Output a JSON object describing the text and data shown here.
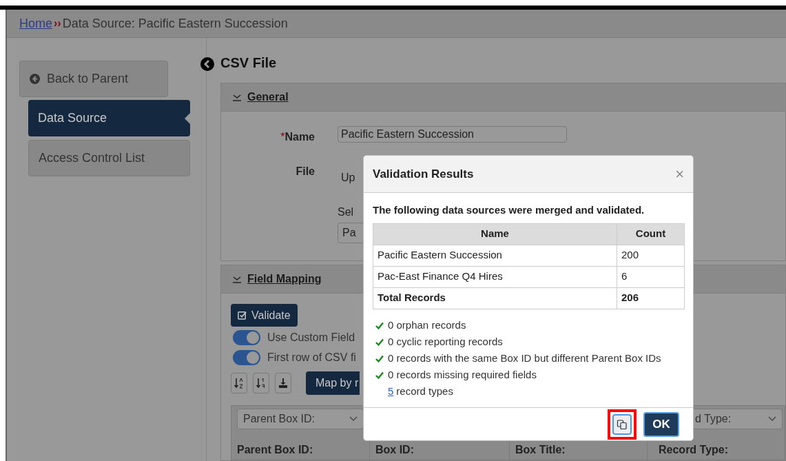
{
  "breadcrumb": {
    "home": "Home",
    "separator": "››",
    "current": "Data Source: Pacific Eastern Succession"
  },
  "sidebar": {
    "back_button": "Back to Parent",
    "items": [
      {
        "label": "Data Source",
        "selected": true
      },
      {
        "label": "Access Control List",
        "selected": false
      }
    ]
  },
  "page_title": "CSV File",
  "general": {
    "title": "General",
    "expanded": true,
    "name_field": {
      "required_mark": "*",
      "label": "Name",
      "value": "Pacific Eastern Succession"
    },
    "file_field": {
      "label": "File",
      "upload_text": "Up",
      "select_label": "Sel",
      "select_value": "Pa"
    }
  },
  "field_mapping": {
    "title": "Field Mapping",
    "expanded": true,
    "validate_button": "Validate",
    "toggles": [
      {
        "label": "Use Custom Field",
        "on": true
      },
      {
        "label": "First row of CSV fi",
        "on": true
      }
    ],
    "map_button": "Map by r",
    "columns": [
      {
        "select": "Parent Box ID:",
        "label": "Parent Box ID:"
      },
      {
        "label": "Box ID:"
      },
      {
        "label": "Box Title:"
      },
      {
        "select": "d Type:",
        "label": "Record Type:"
      }
    ]
  },
  "dialog": {
    "title": "Validation Results",
    "close": "×",
    "intro": "The following data sources were merged and validated.",
    "table": {
      "columns": [
        "Name",
        "Count"
      ],
      "rows": [
        {
          "name": "Pacific Eastern Succession",
          "count": "200"
        },
        {
          "name": "Pac-East Finance Q4 Hires",
          "count": "6"
        }
      ],
      "total": {
        "name": "Total Records",
        "count": "206"
      }
    },
    "checks": [
      {
        "text": "0 orphan records",
        "passed": true
      },
      {
        "text": "0 cyclic reporting records",
        "passed": true
      },
      {
        "text": "0 records with the same Box ID but different Parent Box IDs",
        "passed": true
      },
      {
        "text": "0 records missing required fields",
        "passed": true
      }
    ],
    "record_types": {
      "count": "5",
      "text": "record types"
    },
    "copy_button": {
      "highlighted": true
    },
    "ok_button": "OK"
  }
}
